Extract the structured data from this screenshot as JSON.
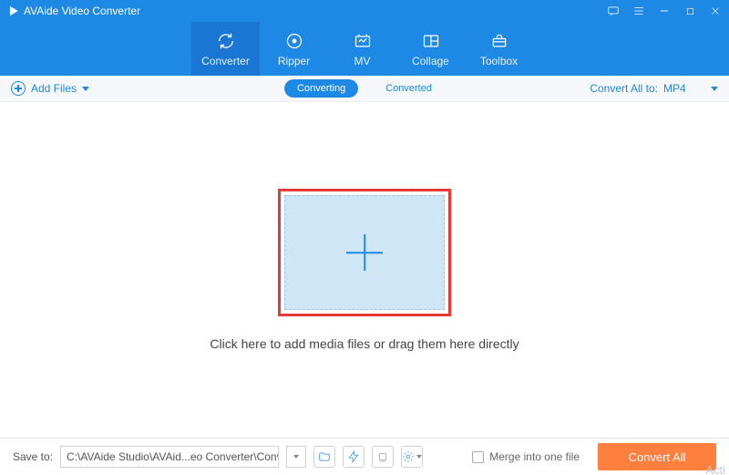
{
  "header": {
    "title": "AVAide Video Converter"
  },
  "window_controls": {
    "feedback": "feedback",
    "menu": "menu",
    "minimize": "minimize",
    "maximize": "maximize",
    "close": "close"
  },
  "nav": [
    {
      "id": "converter",
      "label": "Converter",
      "icon": "converter-icon",
      "active": true
    },
    {
      "id": "ripper",
      "label": "Ripper",
      "icon": "ripper-icon",
      "active": false
    },
    {
      "id": "mv",
      "label": "MV",
      "icon": "mv-icon",
      "active": false
    },
    {
      "id": "collage",
      "label": "Collage",
      "icon": "collage-icon",
      "active": false
    },
    {
      "id": "toolbox",
      "label": "Toolbox",
      "icon": "toolbox-icon",
      "active": false
    }
  ],
  "subbar": {
    "add_files_label": "Add Files",
    "tabs": {
      "converting": "Converting",
      "converted": "Converted",
      "active": "converting"
    },
    "convert_all_to_label": "Convert All to:",
    "convert_all_to_value": "MP4"
  },
  "main": {
    "drop_text": "Click here to add media files or drag them here directly"
  },
  "bottom": {
    "save_to_label": "Save to:",
    "save_path": "C:\\AVAide Studio\\AVAid...eo Converter\\Converted",
    "merge_label": "Merge into one file",
    "convert_button": "Convert All",
    "icon_buttons": [
      "open-folder",
      "speed",
      "gpu-off",
      "settings"
    ]
  },
  "colors": {
    "primary": "#1e88e5",
    "primary_dark": "#1976d2",
    "accent": "#ff7f3f",
    "highlight_border": "#e53935",
    "drop_bg": "#cfe6f7"
  }
}
